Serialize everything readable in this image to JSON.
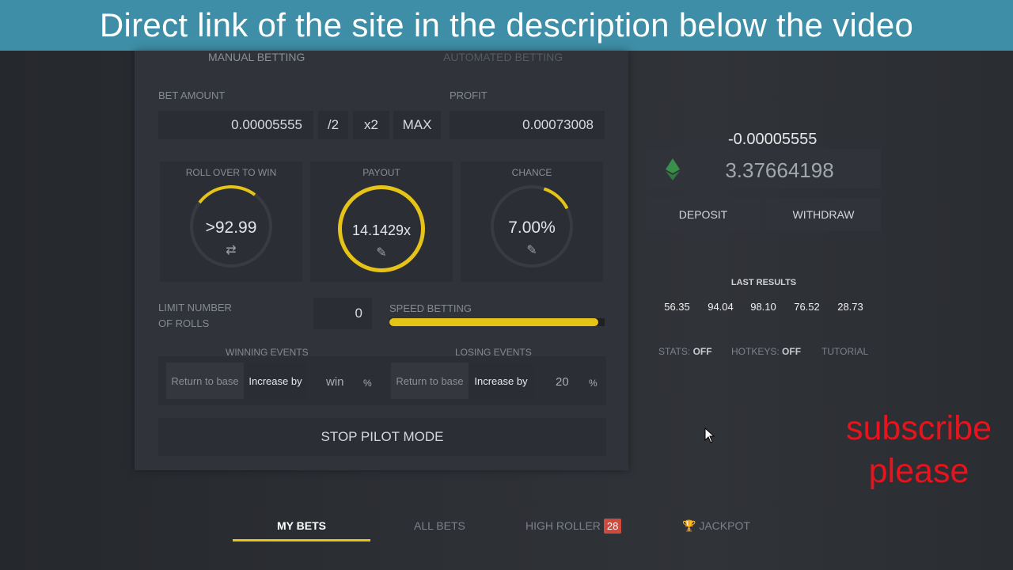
{
  "banner": {
    "text": "Direct link of the site in the description below the video"
  },
  "modes": {
    "manual": "MANUAL BETTING",
    "automated": "AUTOMATED BETTING"
  },
  "bet": {
    "amount_label": "BET AMOUNT",
    "amount_value": "0.00005555",
    "half": "/2",
    "double": "x2",
    "max": "MAX",
    "profit_label": "PROFIT",
    "profit_value": "0.00073008"
  },
  "cards": {
    "roll": {
      "title": "ROLL OVER TO WIN",
      "value": ">92.99"
    },
    "payout": {
      "title": "PAYOUT",
      "value": "14.1429x"
    },
    "chance": {
      "title": "CHANCE",
      "value": "7.00%"
    }
  },
  "rolls": {
    "label_line1": "LIMIT NUMBER",
    "label_line2": "OF ROLLS",
    "value": "0"
  },
  "speed": {
    "label": "SPEED BETTING",
    "level": 0.97
  },
  "winning": {
    "title": "WINNING EVENTS",
    "return_label": "Return to base",
    "increase_label": "Increase by",
    "value": "win",
    "unit": "%"
  },
  "losing": {
    "title": "LOSING EVENTS",
    "return_label": "Return to base",
    "increase_label": "Increase by",
    "value": "20",
    "unit": "%"
  },
  "stop_button": "STOP PILOT MODE",
  "wallet": {
    "delta": "-0.00005555",
    "balance": "3.37664198",
    "deposit": "DEPOSIT",
    "withdraw": "WITHDRAW"
  },
  "last_results": {
    "title": "LAST RESULTS",
    "items": [
      {
        "value": "56.35",
        "color": "#c8453d"
      },
      {
        "value": "94.04",
        "color": "#7aa33b"
      },
      {
        "value": "98.10",
        "color": "#7aa33b"
      },
      {
        "value": "76.52",
        "color": "#c8453d"
      },
      {
        "value": "28.73",
        "color": "#c8453d"
      }
    ]
  },
  "options": {
    "stats_label": "STATS:",
    "stats_value": "OFF",
    "hotkeys_label": "HOTKEYS:",
    "hotkeys_value": "OFF",
    "tutorial": "TUTORIAL"
  },
  "overlay": {
    "subscribe_line1": "subscribe",
    "subscribe_line2": "please"
  },
  "bottom_tabs": {
    "my_bets": "MY BETS",
    "all_bets": "ALL BETS",
    "high_roller": "HIGH ROLLER",
    "high_roller_count": "28",
    "jackpot": "JACKPOT"
  },
  "colors": {
    "accent": "#e6c317",
    "banner": "#3d8ea6",
    "subscribe": "#e8141d"
  }
}
